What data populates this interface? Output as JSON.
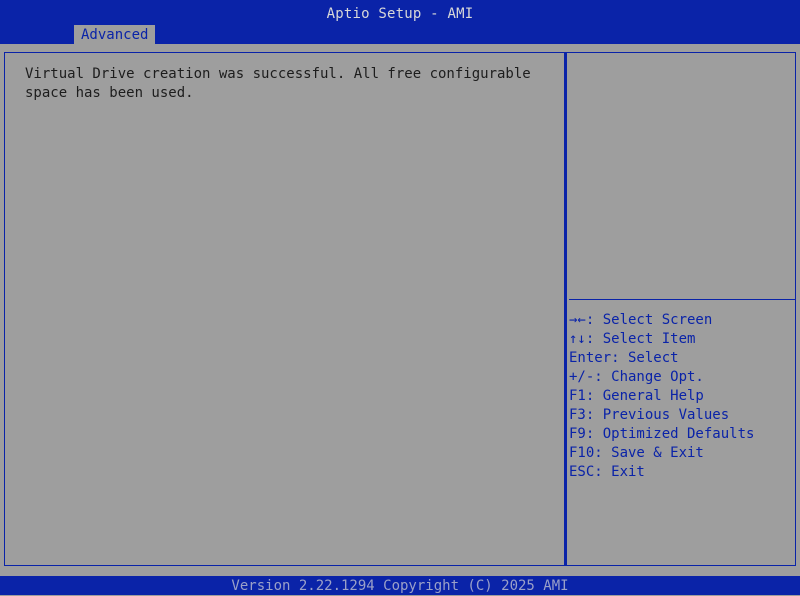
{
  "header": {
    "title": "Aptio Setup - AMI",
    "tabs": [
      {
        "label": "Advanced",
        "selected": true
      }
    ]
  },
  "main": {
    "message": "Virtual Drive creation was successful. All free configurable\nspace has been used."
  },
  "help": {
    "items": [
      "→←: Select Screen",
      "↑↓: Select Item",
      "Enter: Select",
      "+/-: Change Opt.",
      "F1: General Help",
      "F3: Previous Values",
      "F9: Optimized Defaults",
      "F10: Save & Exit",
      "ESC: Exit"
    ]
  },
  "footer": {
    "text": "Version 2.22.1294 Copyright (C) 2025 AMI"
  },
  "colors": {
    "bar": "#0a23a8",
    "background": "#9e9e9e",
    "body_text": "#1d1d1d",
    "help_text": "#0a23a8"
  }
}
